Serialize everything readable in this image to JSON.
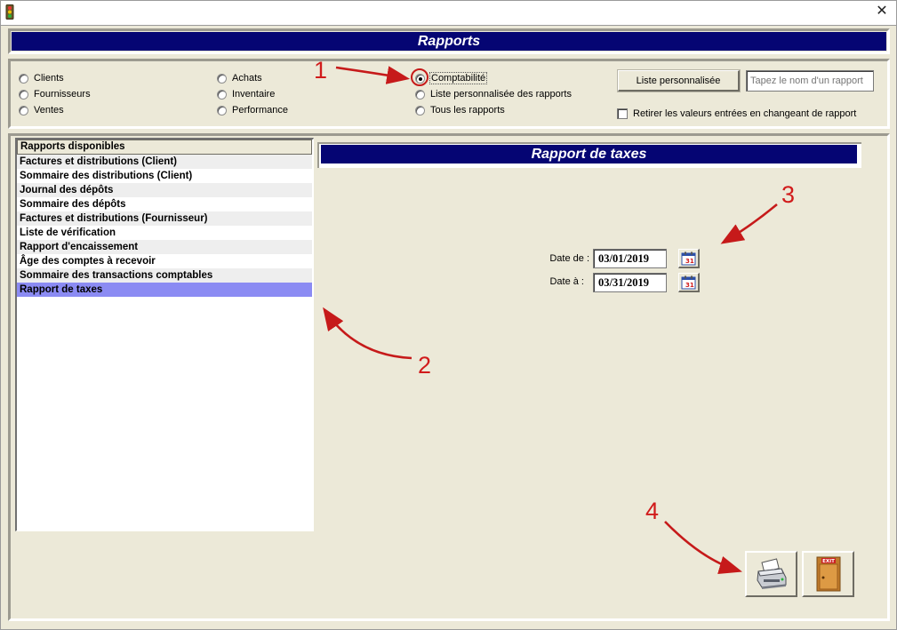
{
  "window": {
    "close_glyph": "✕"
  },
  "header": {
    "title": "Rapports"
  },
  "options": {
    "categories_col1": [
      "Clients",
      "Fournisseurs",
      "Ventes"
    ],
    "categories_col2": [
      "Achats",
      "Inventaire",
      "Performance"
    ],
    "categories_col3": [
      {
        "label": "Comptabilité",
        "checked": true
      },
      {
        "label": "Liste personnalisée des rapports",
        "checked": false
      },
      {
        "label": "Tous les rapports",
        "checked": false
      }
    ],
    "custom_list_button": "Liste personnalisée",
    "report_name_placeholder": "Tapez le nom d'un rapport",
    "clear_values_checkbox": "Retirer les valeurs entrées en changeant de rapport",
    "clear_values_checked": false
  },
  "report_list": {
    "header": "Rapports disponibles",
    "items": [
      "Factures et distributions (Client)",
      "Sommaire des distributions (Client)",
      "Journal des dépôts",
      "Sommaire des dépôts",
      "Factures et distributions (Fournisseur)",
      "Liste de vérification",
      "Rapport d'encaissement",
      "Âge des comptes à recevoir",
      "Sommaire des transactions comptables",
      "Rapport de taxes"
    ],
    "selected_index": 9
  },
  "report_panel": {
    "title": "Rapport de taxes",
    "date_from_label": "Date de :",
    "date_from_value": "03/01/2019",
    "date_to_label": "Date à :",
    "date_to_value": "03/31/2019"
  },
  "actions": {
    "print_icon": "printer-icon",
    "exit_icon": "exit-door-icon",
    "exit_sign_text": "EXIT"
  },
  "annotations": {
    "labels": [
      "1",
      "2",
      "3",
      "4"
    ],
    "color": "#d11b1b"
  },
  "colors": {
    "title_band": "#050573",
    "selection": "#8b8bf3",
    "window_bg": "#ece9d8"
  }
}
